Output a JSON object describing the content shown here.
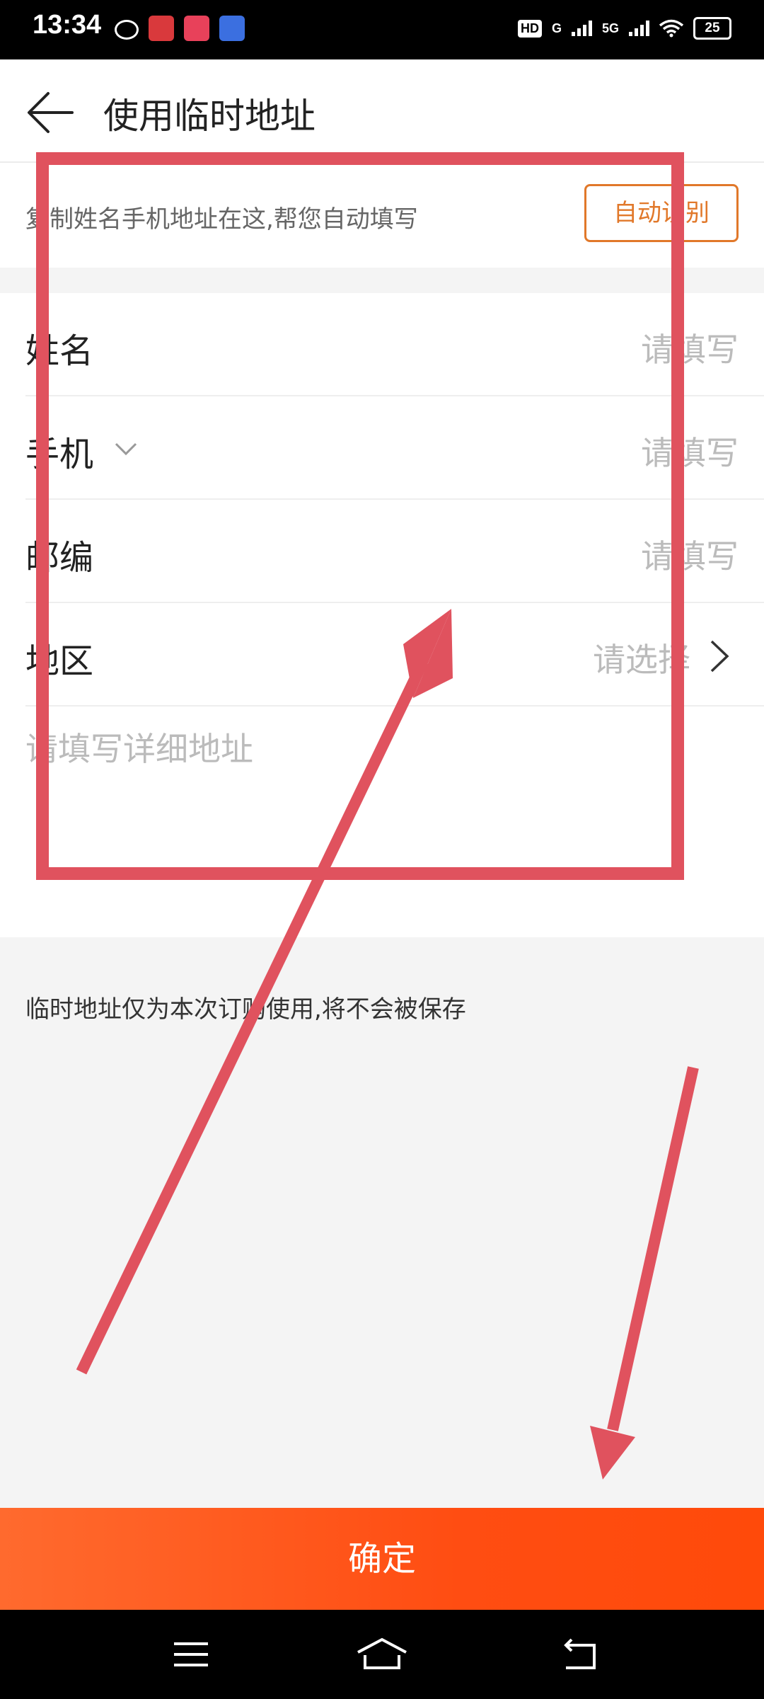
{
  "status_bar": {
    "time": "13:34",
    "hd_label": "HD",
    "network_1": "G",
    "network_2": "5G",
    "battery": "25"
  },
  "header": {
    "title": "使用临时地址",
    "back_icon": "arrow-left-icon"
  },
  "paste": {
    "hint": "复制姓名手机地址在这,帮您自动填写",
    "button_label": "自动识别"
  },
  "form": {
    "name": {
      "label": "姓名",
      "placeholder": "请填写"
    },
    "phone": {
      "label": "手机",
      "placeholder": "请填写"
    },
    "postcode": {
      "label": "邮编",
      "placeholder": "请填写"
    },
    "region": {
      "label": "地区",
      "placeholder": "请选择"
    },
    "detail_placeholder": "请填写详细地址"
  },
  "note": "临时地址仅为本次订购使用,将不会被保存",
  "confirm_label": "确定",
  "nav": {
    "icons": [
      "menu-icon",
      "home-icon",
      "back-icon"
    ]
  },
  "colors": {
    "accent": "#e1782a",
    "confirm": "#ff5317",
    "annotation": "#e0525e"
  }
}
